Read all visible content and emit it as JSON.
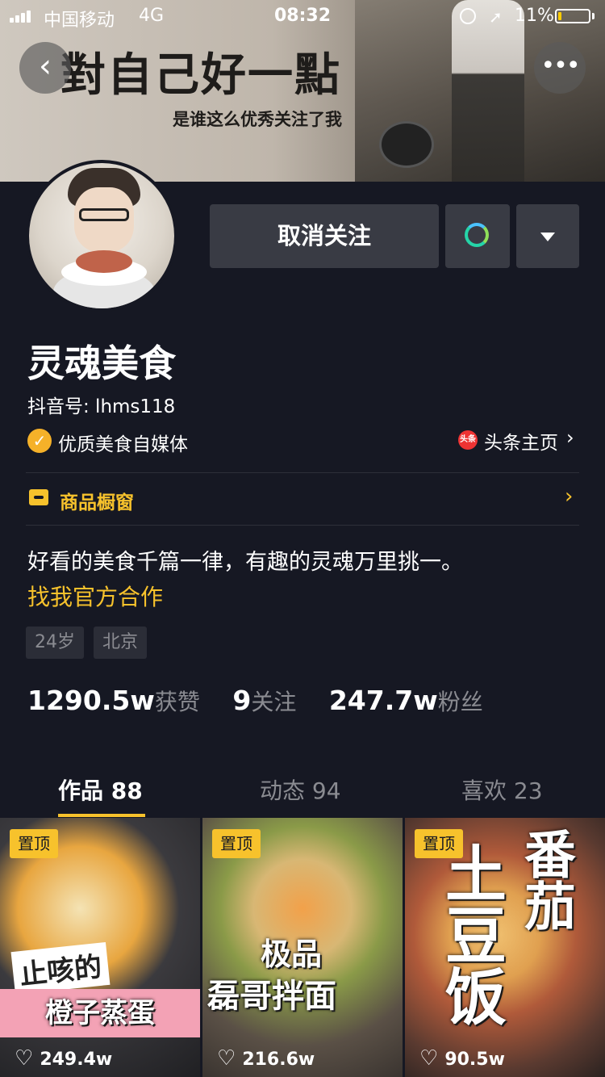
{
  "status_bar": {
    "carrier": "中国移动",
    "network": "4G",
    "time": "08:32",
    "battery": "11%",
    "battery_level": 0.11
  },
  "banner": {
    "title": "對自己好一點",
    "subtitle": "是谁这么优秀关注了我"
  },
  "actions": {
    "unfollow_label": "取消关注"
  },
  "profile": {
    "name": "灵魂美食",
    "douyin_id": "抖音号: lhms118",
    "verification": "优质美食自媒体",
    "toutiao_badge": "头条",
    "toutiao_link": "头条主页",
    "shop": "商品橱窗",
    "bio": "好看的美食千篇一律，有趣的灵魂万里挑一。",
    "cooperation": "找我官方合作",
    "tags": [
      "24岁",
      "北京"
    ]
  },
  "stats": [
    {
      "value": "1290.5w",
      "label": "获赞"
    },
    {
      "value": "9",
      "label": "关注"
    },
    {
      "value": "247.7w",
      "label": "粉丝"
    }
  ],
  "tabs": [
    {
      "label": "作品 88",
      "active": true
    },
    {
      "label": "动态 94",
      "active": false
    },
    {
      "label": "喜欢 23",
      "active": false
    }
  ],
  "videos": [
    {
      "badge": "置顶",
      "likes": "249.4w",
      "caption_line1": "止咳的",
      "caption_line2": "橙子蒸蛋"
    },
    {
      "badge": "置顶",
      "likes": "216.6w",
      "caption_line1": "极品",
      "caption_line2": "磊哥拌面"
    },
    {
      "badge": "置顶",
      "likes": "90.5w",
      "caption_line1": "番茄",
      "caption_line2": "土豆饭"
    }
  ],
  "colors": {
    "background": "#161823",
    "accent": "#f7c22c",
    "button": "#393b44",
    "muted_text": "#8a8b91"
  }
}
